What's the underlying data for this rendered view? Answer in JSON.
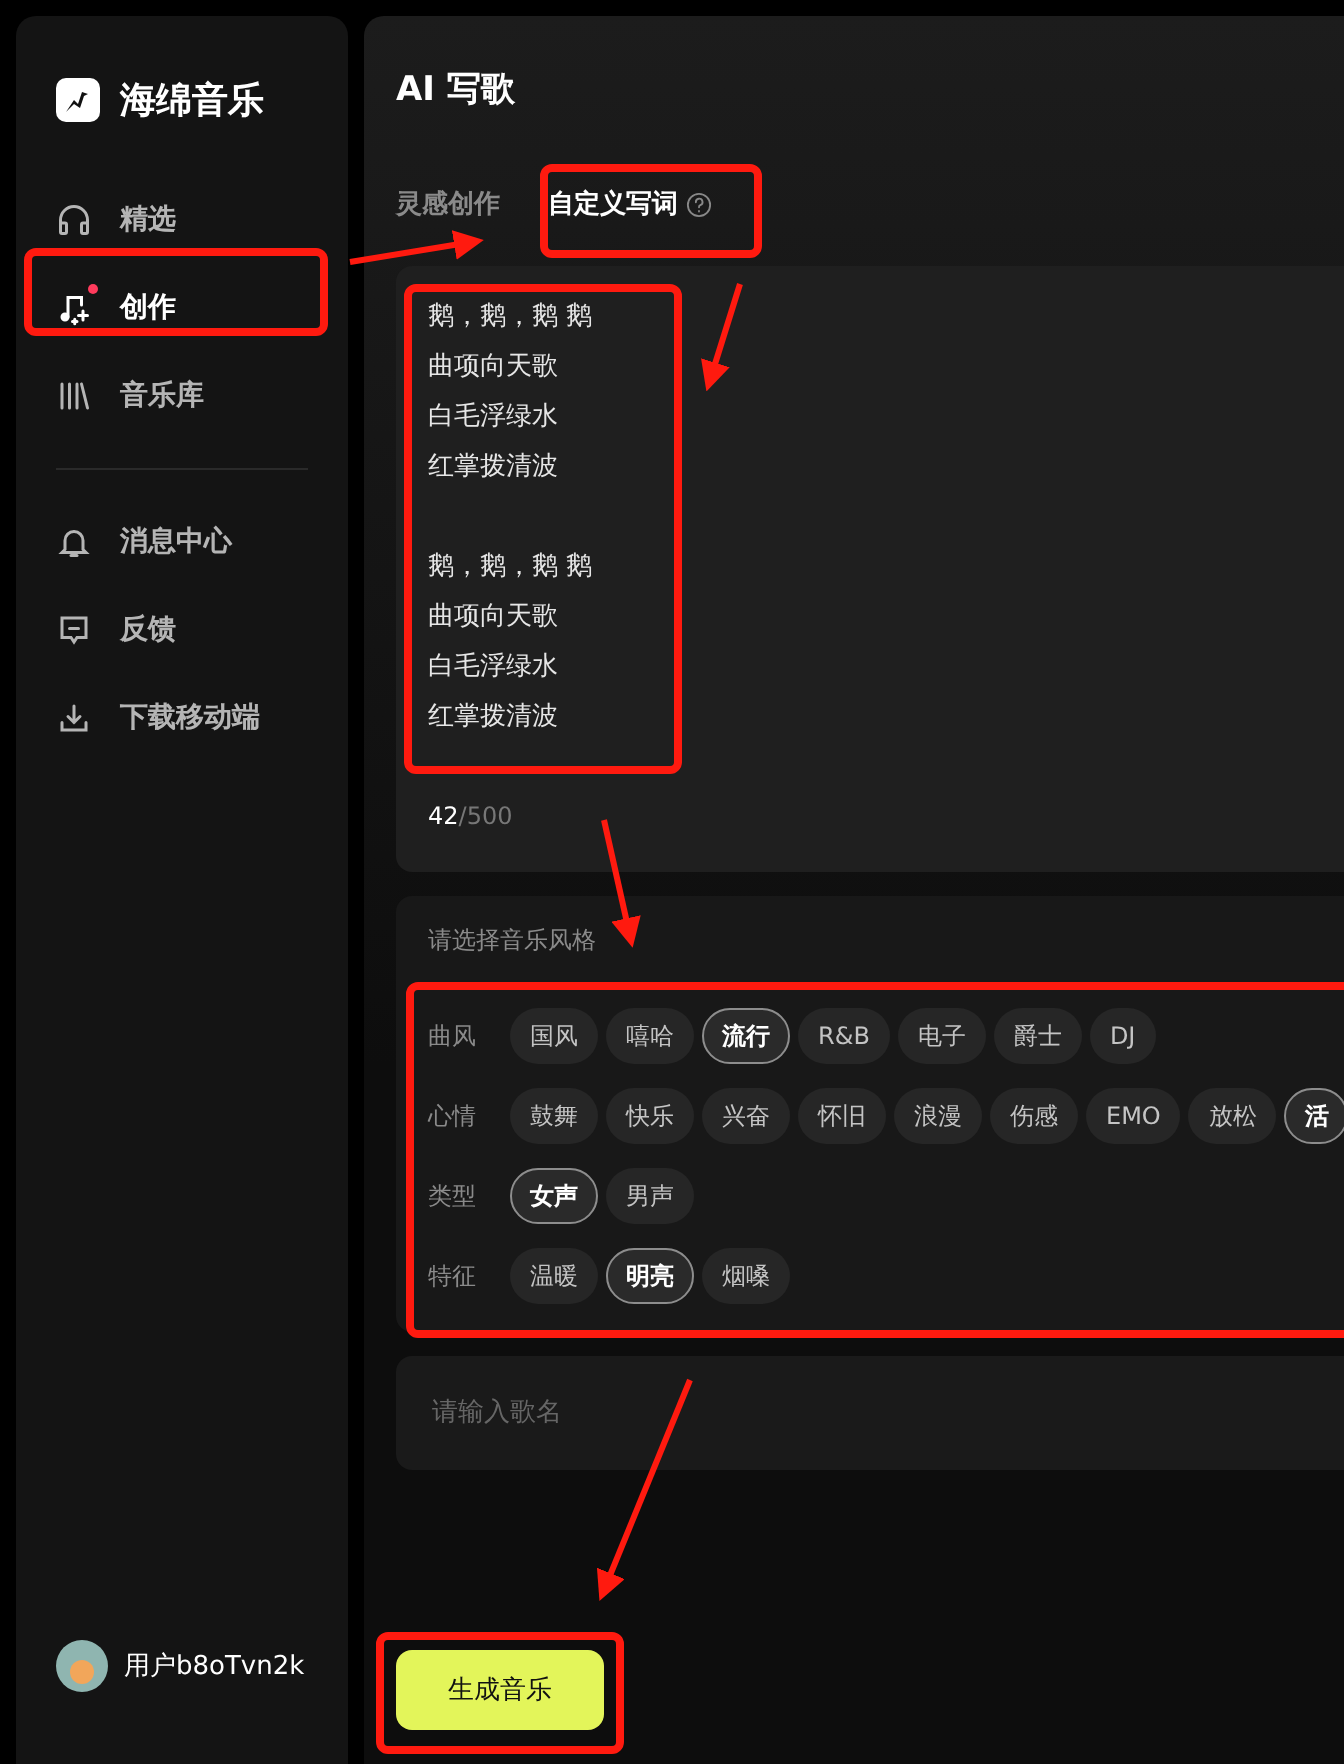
{
  "sidebar": {
    "brand": "海绵音乐",
    "items": [
      {
        "label": "精选",
        "selected": false,
        "badge": false
      },
      {
        "label": "创作",
        "selected": true,
        "badge": true
      },
      {
        "label": "音乐库",
        "selected": false,
        "badge": false
      }
    ],
    "more_items": [
      {
        "label": "消息中心",
        "selected": false,
        "badge": false
      },
      {
        "label": "反馈",
        "selected": false,
        "badge": false
      },
      {
        "label": "下载移动端",
        "selected": false,
        "badge": false
      }
    ],
    "user": "用户b8oTvn2k"
  },
  "title": "AI 写歌",
  "tabs": [
    {
      "label": "灵感创作",
      "selected": false,
      "help": false
    },
    {
      "label": "自定义写词",
      "selected": true,
      "help": true
    }
  ],
  "lyrics": {
    "stanzas": [
      [
        "鹅，鹅，鹅 鹅",
        "曲项向天歌",
        "白毛浮绿水",
        "红掌拨清波"
      ],
      [
        "鹅，鹅，鹅 鹅",
        "曲项向天歌",
        "白毛浮绿水",
        "红掌拨清波"
      ]
    ],
    "count": "42",
    "limit": "/500"
  },
  "style": {
    "heading": "请选择音乐风格",
    "rows": [
      {
        "label": "曲风",
        "chips": [
          {
            "label": "国风",
            "selected": false
          },
          {
            "label": "嘻哈",
            "selected": false
          },
          {
            "label": "流行",
            "selected": true
          },
          {
            "label": "R&B",
            "selected": false
          },
          {
            "label": "电子",
            "selected": false
          },
          {
            "label": "爵士",
            "selected": false
          },
          {
            "label": "DJ",
            "selected": false
          }
        ]
      },
      {
        "label": "心情",
        "chips": [
          {
            "label": "鼓舞",
            "selected": false
          },
          {
            "label": "快乐",
            "selected": false
          },
          {
            "label": "兴奋",
            "selected": false
          },
          {
            "label": "怀旧",
            "selected": false
          },
          {
            "label": "浪漫",
            "selected": false
          },
          {
            "label": "伤感",
            "selected": false
          },
          {
            "label": "EMO",
            "selected": false
          },
          {
            "label": "放松",
            "selected": false
          },
          {
            "label": "活",
            "selected": true
          }
        ]
      },
      {
        "label": "类型",
        "chips": [
          {
            "label": "女声",
            "selected": true
          },
          {
            "label": "男声",
            "selected": false
          }
        ]
      },
      {
        "label": "特征",
        "chips": [
          {
            "label": "温暖",
            "selected": false
          },
          {
            "label": "明亮",
            "selected": true
          },
          {
            "label": "烟嗓",
            "selected": false
          }
        ]
      }
    ]
  },
  "song_name": {
    "placeholder": "请输入歌名"
  },
  "generate_button": "生成音乐"
}
